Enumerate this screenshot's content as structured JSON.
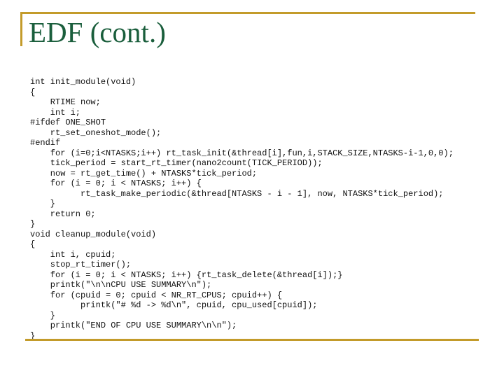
{
  "slide": {
    "title": "EDF (cont.)",
    "accent_color": "#c39b2a",
    "title_color": "#1a5e3c"
  },
  "code": {
    "lines": [
      "int init_module(void)",
      "{",
      "    RTIME now;",
      "    int i;",
      "#ifdef ONE_SHOT",
      "    rt_set_oneshot_mode();",
      "#endif",
      "    for (i=0;i<NTASKS;i++) rt_task_init(&thread[i],fun,i,STACK_SIZE,NTASKS-i-1,0,0);",
      "    tick_period = start_rt_timer(nano2count(TICK_PERIOD));",
      "    now = rt_get_time() + NTASKS*tick_period;",
      "    for (i = 0; i < NTASKS; i++) {",
      "          rt_task_make_periodic(&thread[NTASKS - i - 1], now, NTASKS*tick_period);",
      "    }",
      "    return 0;",
      "}",
      "void cleanup_module(void)",
      "{",
      "    int i, cpuid;",
      "    stop_rt_timer();",
      "    for (i = 0; i < NTASKS; i++) {rt_task_delete(&thread[i]);}",
      "    printk(\"\\n\\nCPU USE SUMMARY\\n\");",
      "    for (cpuid = 0; cpuid < NR_RT_CPUS; cpuid++) {",
      "          printk(\"# %d -> %d\\n\", cpuid, cpu_used[cpuid]);",
      "    }",
      "    printk(\"END OF CPU USE SUMMARY\\n\\n\");",
      "}"
    ]
  }
}
